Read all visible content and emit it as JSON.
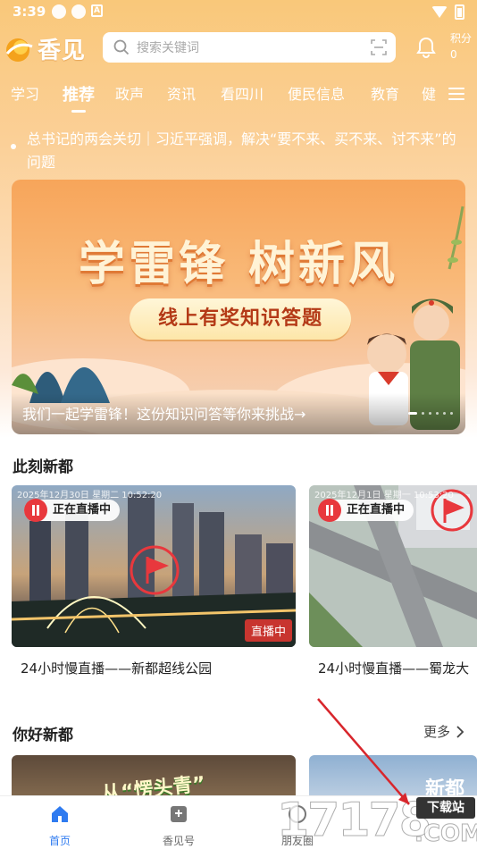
{
  "status_bar": {
    "time": "3:39"
  },
  "header": {
    "logo_text": "香见",
    "search_placeholder": "搜索关键词",
    "points_label": "积分",
    "points_value": "0"
  },
  "tabs": [
    {
      "label": "学习"
    },
    {
      "label": "推荐"
    },
    {
      "label": "政声"
    },
    {
      "label": "资讯"
    },
    {
      "label": "看四川"
    },
    {
      "label": "便民信息"
    },
    {
      "label": "教育"
    },
    {
      "label": "健"
    }
  ],
  "ticker": {
    "text": "总书记的两会关切｜习近平强调，解决“要不来、买不来、讨不来”的问题"
  },
  "banner": {
    "title": "学雷锋  树新风",
    "subtitle": "线上有奖知识答题",
    "caption": "我们一起学雷锋！这份知识问答等你来挑战→"
  },
  "section_live": {
    "title": "此刻新都",
    "cards": [
      {
        "badge": "正在直播中",
        "overlay": "2025年12月30日 星期二 10:52:20",
        "on_air": "直播中",
        "caption": "24小时慢直播——新都超线公园"
      },
      {
        "badge": "正在直播中",
        "overlay": "2025年12月1日 星期一 10:53:20",
        "caption": "24小时慢直播——蜀龙大"
      }
    ]
  },
  "section_hello": {
    "title": "你好新都",
    "more": "更多",
    "card1_text": "从“愣头青”",
    "card2_text": "新都"
  },
  "bottom_nav": [
    {
      "label": "首页"
    },
    {
      "label": "香见号"
    },
    {
      "label": "朋友圈"
    }
  ],
  "watermark": {
    "digits": "17178",
    "badge": "下载站",
    "suffix": ".COM"
  },
  "colors": {
    "accent_blue": "#2f7bf0",
    "live_red": "#e8383d",
    "header_orange": "#f9c87a"
  }
}
